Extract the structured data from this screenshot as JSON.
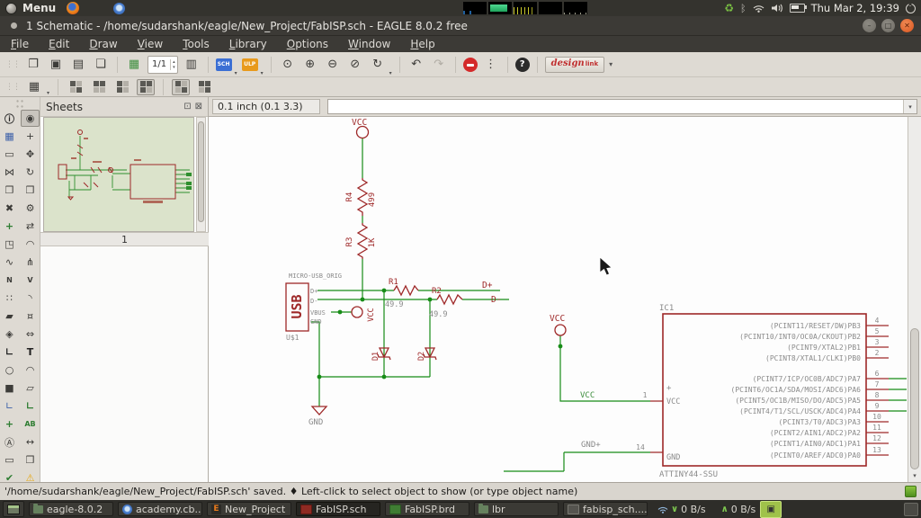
{
  "colors": {
    "symbol_maroon": "#9e2828",
    "net_green": "#178c17",
    "net_label_green": "#3f8f3f",
    "schematic_gray": "#8a8a8a",
    "toolbar_bg": "#dedad3",
    "dark_bar": "#34332e",
    "close_button_orange": "#d9541e",
    "sch_badge_blue": "#3b6fd4",
    "ulp_badge_orange": "#e89a1c",
    "thumbnail_green": "#dbe3cb"
  },
  "desktop": {
    "menu_label": "Menu",
    "clock": "Thu Mar 2, 19:39"
  },
  "window": {
    "title": "1 Schematic - /home/sudarshank/eagle/New_Project/FabISP.sch - EAGLE 8.0.2 free",
    "menus": [
      "File",
      "Edit",
      "Draw",
      "View",
      "Tools",
      "Library",
      "Options",
      "Window",
      "Help"
    ]
  },
  "toolbar": {
    "sheet_selector": "1/1",
    "sch_badge": "SCH",
    "ulp_badge": "ULP",
    "design_word1": "design",
    "design_word2": "link"
  },
  "icons": {
    "open": "❐",
    "save": "▣",
    "print": "▤",
    "image": "❏",
    "board": "▦",
    "library": "▥",
    "zoom_fit": "⊙",
    "zoom_in": "⊕",
    "zoom_out": "⊖",
    "zoom_select": "⊘",
    "zoom_redraw": "↻",
    "undo": "↶",
    "redo": "↷",
    "dots": "⋮",
    "help": "?",
    "grid": "▦",
    "caret": "▾",
    "spin_up": "▴",
    "spin_down": "▾",
    "sheets_float": "⊡",
    "sheets_close": "⊠",
    "win_min": "–",
    "win_max": "□",
    "win_close": "✕",
    "recycle": "♻",
    "bluetooth": "ᛒ",
    "net_down_arrow": "∨",
    "net_up_arrow": "∧",
    "scroll_down": "▾"
  },
  "palette": {
    "rows": [
      [
        "ⓘ",
        "◉"
      ],
      [
        "▦",
        "+"
      ],
      [
        "▭",
        "✥"
      ],
      [
        "⋈",
        "↻"
      ],
      [
        "❐",
        "❒"
      ],
      [
        "✖",
        "⚙"
      ],
      [
        "+",
        "⇄"
      ],
      [
        "◳",
        "◠"
      ],
      [
        "∿",
        "⋔"
      ],
      [
        "N",
        "V"
      ],
      [
        "∷",
        "◝"
      ],
      [
        "▰",
        "¤"
      ],
      [
        "◈",
        "⇔"
      ],
      [
        "∟",
        "T"
      ],
      [
        "○",
        "◠"
      ],
      [
        "■",
        "▱"
      ],
      [
        "∟",
        "∟"
      ],
      [
        "+",
        "AB"
      ],
      [
        "Ⓐ",
        "↔"
      ],
      [
        "▭",
        "❒"
      ],
      [
        "✔",
        "⚠"
      ]
    ]
  },
  "coord_bar": {
    "coords": "0.1 inch (0.1 3.3)",
    "command_value": ""
  },
  "sheets_panel": {
    "title": "Sheets",
    "sheet_label": "1"
  },
  "schematic": {
    "vcc_top": "VCC",
    "r4_name": "R4",
    "r4_value": "499",
    "r3_name": "R3",
    "r3_value": "1K",
    "usb_header": "MICRO-USB_ORIG",
    "usb_body": "USB",
    "usb_refdes": "U$1",
    "usb_pin_dplus": "D+",
    "usb_pin_dminus": "D-",
    "usb_pin_vbus": "VBUS",
    "usb_pin_gnd": "GND",
    "vcc_usb": "VCC",
    "r1_name": "R1",
    "r1_value": "49.9",
    "r2_name": "R2",
    "r2_value": "49.9",
    "net_dplus": "D+",
    "net_dminus": "D-",
    "d1_name": "D1",
    "d2_name": "D2",
    "gnd_label": "GND",
    "vcc_mid": "VCC",
    "vcc_net_label": "VCC",
    "vcc_pin_number": "1",
    "gnd_net_label": "GND+",
    "gnd_pin_number": "14",
    "ic1_name": "IC1",
    "ic1_value": "ATTINY44-SSU",
    "ic1_plus": "+",
    "ic1_vcc": "VCC",
    "ic1_gnd": "GND",
    "ic1_pins": [
      {
        "label": "(PCINT11/RESET/DW)PB3",
        "number": "4"
      },
      {
        "label": "(PCINT10/INT0/OC0A/CKOUT)PB2",
        "number": "5"
      },
      {
        "label": "(PCINT9/XTAL2)PB1",
        "number": "3"
      },
      {
        "label": "(PCINT8/XTAL1/CLKI)PB0",
        "number": "2"
      },
      {
        "label": "(PCINT7/ICP/OC0B/ADC7)PA7",
        "number": "6"
      },
      {
        "label": "(PCINT6/OC1A/SDA/MOSI/ADC6)PA6",
        "number": "7"
      },
      {
        "label": "(PCINT5/OC1B/MISO/DO/ADC5)PA5",
        "number": "8"
      },
      {
        "label": "(PCINT4/T1/SCL/USCK/ADC4)PA4",
        "number": "9"
      },
      {
        "label": "(PCINT3/T0/ADC3)PA3",
        "number": "10"
      },
      {
        "label": "(PCINT2/AIN1/ADC2)PA2",
        "number": "11"
      },
      {
        "label": "(PCINT1/AIN0/ADC1)PA1",
        "number": "12"
      },
      {
        "label": "(PCINT0/AREF/ADC0)PA0",
        "number": "13"
      }
    ]
  },
  "status_bar": {
    "message": "'/home/sudarshank/eagle/New_Project/FabISP.sch' saved.  ♦ Left-click to select object to show (or type object name)"
  },
  "taskbar": {
    "items": [
      "eagle-8.0.2",
      "academy.cb...",
      "New_Project",
      "FabISP.sch",
      "FabISP.brd",
      "lbr",
      "fabisp_sch...."
    ],
    "net_down": "0 B/s",
    "net_up": "0 B/s"
  }
}
